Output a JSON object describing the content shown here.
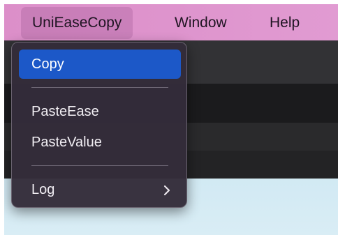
{
  "menubar": {
    "items": [
      {
        "label": "UniEaseCopy",
        "active": true
      },
      {
        "label": "Window",
        "active": false
      },
      {
        "label": "Help",
        "active": false
      }
    ]
  },
  "dropdown": {
    "items": [
      {
        "label": "Copy",
        "highlighted": true
      },
      {
        "label": "PasteEase"
      },
      {
        "label": "PasteValue"
      },
      {
        "label": "Log",
        "submenu": true,
        "submenu_icon": "chevron-right-icon"
      }
    ]
  },
  "colors": {
    "menubar_accent": "#dc8fc9",
    "highlight": "#1c58c8",
    "menu_background": "#342c3a"
  }
}
